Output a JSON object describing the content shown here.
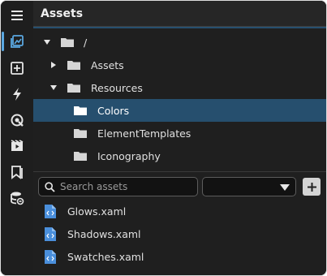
{
  "panel": {
    "title": "Assets"
  },
  "activity_bar": {
    "items": [
      {
        "icon": "hamburger-menu-icon",
        "active": false
      },
      {
        "icon": "image-gallery-icon",
        "active": true
      },
      {
        "icon": "add-box-icon",
        "active": false
      },
      {
        "icon": "lightning-icon",
        "active": false
      },
      {
        "icon": "color-picker-icon",
        "active": false
      },
      {
        "icon": "video-icon",
        "active": false
      },
      {
        "icon": "bookmarks-icon",
        "active": false
      },
      {
        "icon": "database-link-icon",
        "active": false
      }
    ]
  },
  "tree": [
    {
      "label": "/",
      "expanded": true,
      "selected": false
    },
    {
      "label": "Assets",
      "expanded": false,
      "selected": false
    },
    {
      "label": "Resources",
      "expanded": true,
      "selected": false
    },
    {
      "label": "Colors",
      "expanded": false,
      "selected": true
    },
    {
      "label": "ElementTemplates",
      "expanded": false,
      "selected": false
    },
    {
      "label": "Iconography",
      "expanded": false,
      "selected": false
    }
  ],
  "search": {
    "placeholder": "Search assets",
    "value": ""
  },
  "filter": {
    "selected": ""
  },
  "files": [
    {
      "name": "Glows.xaml"
    },
    {
      "name": "Shadows.xaml"
    },
    {
      "name": "Swatches.xaml"
    }
  ],
  "colors": {
    "accent": "#5aa7e0",
    "selection": "#264f6e",
    "file_icon": "#4a8fdc"
  }
}
